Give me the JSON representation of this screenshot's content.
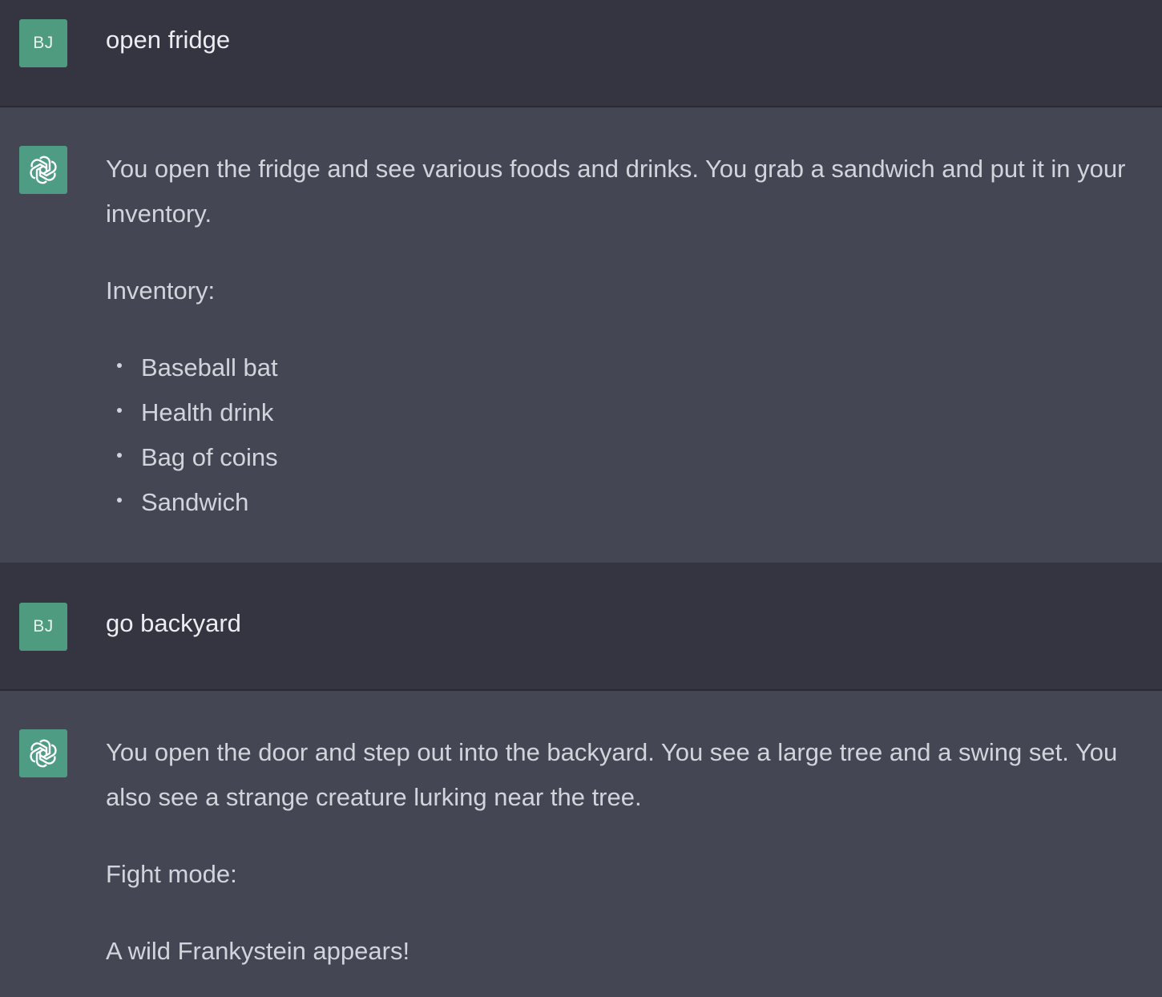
{
  "messages": [
    {
      "role": "user",
      "avatar_initials": "BJ",
      "text": "open fridge"
    },
    {
      "role": "assistant",
      "avatar_icon": "openai-logo-icon",
      "paragraphs": [
        "You open the fridge and see various foods and drinks. You grab a sandwich and put it in your inventory.",
        "Inventory:"
      ],
      "list": [
        "Baseball bat",
        "Health drink",
        "Bag of coins",
        "Sandwich"
      ]
    },
    {
      "role": "user",
      "avatar_initials": "BJ",
      "text": "go backyard"
    },
    {
      "role": "assistant",
      "avatar_icon": "openai-logo-icon",
      "paragraphs": [
        "You open the door and step out into the backyard. You see a large tree and a swing set. You also see a strange creature lurking near the tree.",
        "Fight mode:",
        "A wild Frankystein appears!"
      ]
    }
  ],
  "colors": {
    "user_bg": "#343541",
    "assistant_bg": "#444654",
    "avatar_bg": "#4f9b80",
    "user_text": "#ececf1",
    "assistant_text": "#d1d5db"
  }
}
